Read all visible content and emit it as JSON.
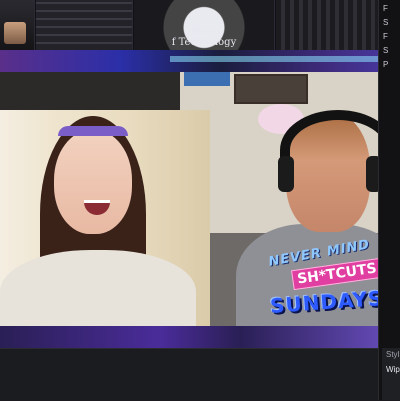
{
  "thumbnails": {
    "logo_line1": "ence",
    "logo_line2": "f Technology"
  },
  "side_panel": {
    "labels": [
      "F",
      "S",
      "F",
      "S",
      "P"
    ]
  },
  "overlay": {
    "sign_text": "",
    "brand_line1": "NEVER MIND",
    "brand_line2": "SH*TCUTS",
    "brand_line3": "SUNDAYS"
  },
  "bottom_panel": {
    "style_label": "Styl",
    "wipe_label": "Wipe"
  }
}
